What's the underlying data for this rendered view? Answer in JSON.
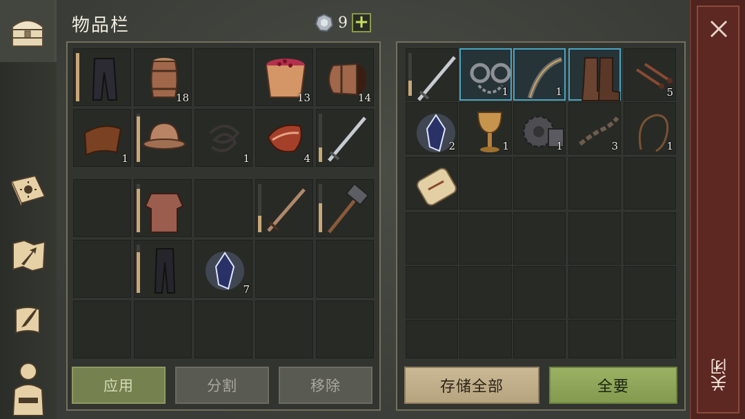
{
  "header": {
    "title": "物品栏",
    "currency_count": "9",
    "add_label": "+"
  },
  "close": {
    "label": "关闭"
  },
  "sidebar": {
    "items": [
      {
        "name": "chest-icon"
      },
      {
        "name": "sun-book-icon"
      },
      {
        "name": "map-arrow-icon"
      },
      {
        "name": "quill-scroll-icon"
      },
      {
        "name": "character-icon"
      }
    ]
  },
  "left_inventory": {
    "top": [
      {
        "icon": "pants-icon",
        "count": "",
        "durability": 1.0
      },
      {
        "icon": "barrel-icon",
        "count": "18"
      },
      {
        "icon": "",
        "count": ""
      },
      {
        "icon": "berry-bucket-icon",
        "count": "13"
      },
      {
        "icon": "barrel-side-icon",
        "count": "14"
      },
      {
        "icon": "leather-icon",
        "count": "1"
      },
      {
        "icon": "helmet-icon",
        "count": "",
        "durability": 0.95
      },
      {
        "icon": "rope-icon",
        "count": "1"
      },
      {
        "icon": "meat-icon",
        "count": "4"
      },
      {
        "icon": "sword-icon",
        "count": "",
        "durability": 0.3
      }
    ],
    "equip": [
      {
        "icon": "",
        "count": ""
      },
      {
        "icon": "chainmail-icon",
        "count": "",
        "durability": 0.9
      },
      {
        "icon": "",
        "count": ""
      },
      {
        "icon": "wood-sword-icon",
        "count": "",
        "durability": 0.35
      },
      {
        "icon": "hammer-icon",
        "count": "",
        "durability": 0.6
      },
      {
        "icon": "",
        "count": ""
      },
      {
        "icon": "leggings-icon",
        "count": "",
        "durability": 0.85
      },
      {
        "icon": "crystal-icon",
        "count": "7"
      },
      {
        "icon": "",
        "count": ""
      },
      {
        "icon": "",
        "count": ""
      }
    ],
    "buttons": {
      "apply": "应用",
      "split": "分割",
      "remove": "移除"
    }
  },
  "right_storage": {
    "slots": [
      {
        "icon": "sword-icon",
        "count": "",
        "durability": 0.35
      },
      {
        "icon": "shackles-icon",
        "count": "1",
        "highlight": true
      },
      {
        "icon": "bow-icon",
        "count": "1",
        "highlight": true
      },
      {
        "icon": "boots-icon",
        "count": "",
        "highlight": true
      },
      {
        "icon": "nails-icon",
        "count": "5"
      },
      {
        "icon": "crystal-icon",
        "count": "2"
      },
      {
        "icon": "goblet-icon",
        "count": "1"
      },
      {
        "icon": "gear-icon",
        "count": "1"
      },
      {
        "icon": "chain-icon",
        "count": "3"
      },
      {
        "icon": "whip-icon",
        "count": "1"
      },
      {
        "icon": "scroll-icon",
        "count": ""
      }
    ],
    "buttons": {
      "store_all": "存储全部",
      "take_all": "全要"
    }
  },
  "colors": {
    "apply_btn": "#7d8a5a",
    "take_all_btn": "#8ea55a",
    "store_btn": "#c2b08e",
    "highlight": "#48a6c5",
    "close_bg": "#5d2822"
  }
}
